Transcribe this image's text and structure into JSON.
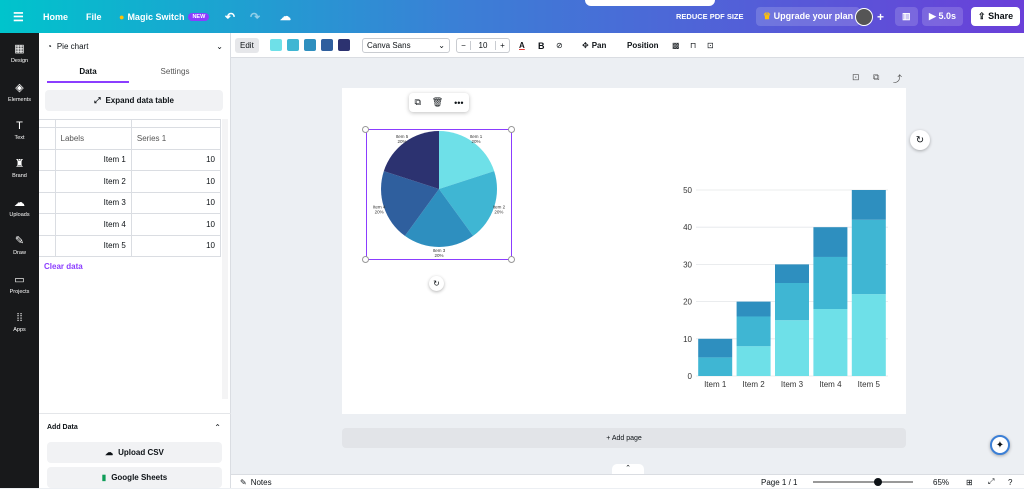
{
  "topbar": {
    "home": "Home",
    "file": "File",
    "magic_switch": "Magic Switch",
    "new_badge": "NEW",
    "reduce_pdf": "REDUCE PDF SIZE",
    "upgrade": "Upgrade your plan",
    "present_time": "5.0s",
    "share": "Share"
  },
  "rail": [
    "Design",
    "Elements",
    "Text",
    "Brand",
    "Uploads",
    "Draw",
    "Projects",
    "Apps"
  ],
  "panel": {
    "chart_type": "Pie chart",
    "tabs": [
      "Data",
      "Settings"
    ],
    "expand": "Expand data table",
    "table_headers": [
      "Labels",
      "Series 1"
    ],
    "rows": [
      {
        "label": "Item 1",
        "value": "10"
      },
      {
        "label": "Item 2",
        "value": "10"
      },
      {
        "label": "Item 3",
        "value": "10"
      },
      {
        "label": "Item 4",
        "value": "10"
      },
      {
        "label": "Item 5",
        "value": "10"
      }
    ],
    "clear": "Clear data",
    "add_data": "Add Data",
    "upload_csv": "Upload CSV",
    "google_sheets": "Google Sheets"
  },
  "toolbar": {
    "edit": "Edit",
    "colors": [
      "#6ee0e8",
      "#3fb6d3",
      "#2e8fbf",
      "#2f5f9e",
      "#2c3270"
    ],
    "font": "Canva Sans",
    "font_size": "10",
    "pan": "Pan",
    "position": "Position"
  },
  "canvas": {
    "add_page": "+ Add page"
  },
  "bottombar": {
    "notes": "Notes",
    "page": "Page 1 / 1",
    "zoom": "65%",
    "zoom_level": 0.65
  },
  "chart_data": [
    {
      "type": "pie",
      "categories": [
        "Item 1",
        "Item 2",
        "Item 3",
        "Item 4",
        "Item 5"
      ],
      "values": [
        10,
        10,
        10,
        10,
        10
      ],
      "percent_labels": [
        "20%",
        "20%",
        "20%",
        "20%",
        "20%"
      ],
      "colors": [
        "#6ee0e8",
        "#3fb6d3",
        "#2e8fbf",
        "#2f5f9e",
        "#2c3270"
      ]
    },
    {
      "type": "bar",
      "stacked": true,
      "categories": [
        "Item 1",
        "Item 2",
        "Item 3",
        "Item 4",
        "Item 5"
      ],
      "series": [
        {
          "values": [
            0,
            8,
            15,
            18,
            22
          ],
          "color": "#6ee0e8"
        },
        {
          "values": [
            5,
            8,
            10,
            14,
            20
          ],
          "color": "#3fb6d3"
        },
        {
          "values": [
            5,
            4,
            5,
            8,
            8
          ],
          "color": "#2e8fbf"
        }
      ],
      "yticks": [
        0,
        10,
        20,
        30,
        40,
        50
      ],
      "ylim": [
        0,
        50
      ],
      "grid": true
    }
  ]
}
